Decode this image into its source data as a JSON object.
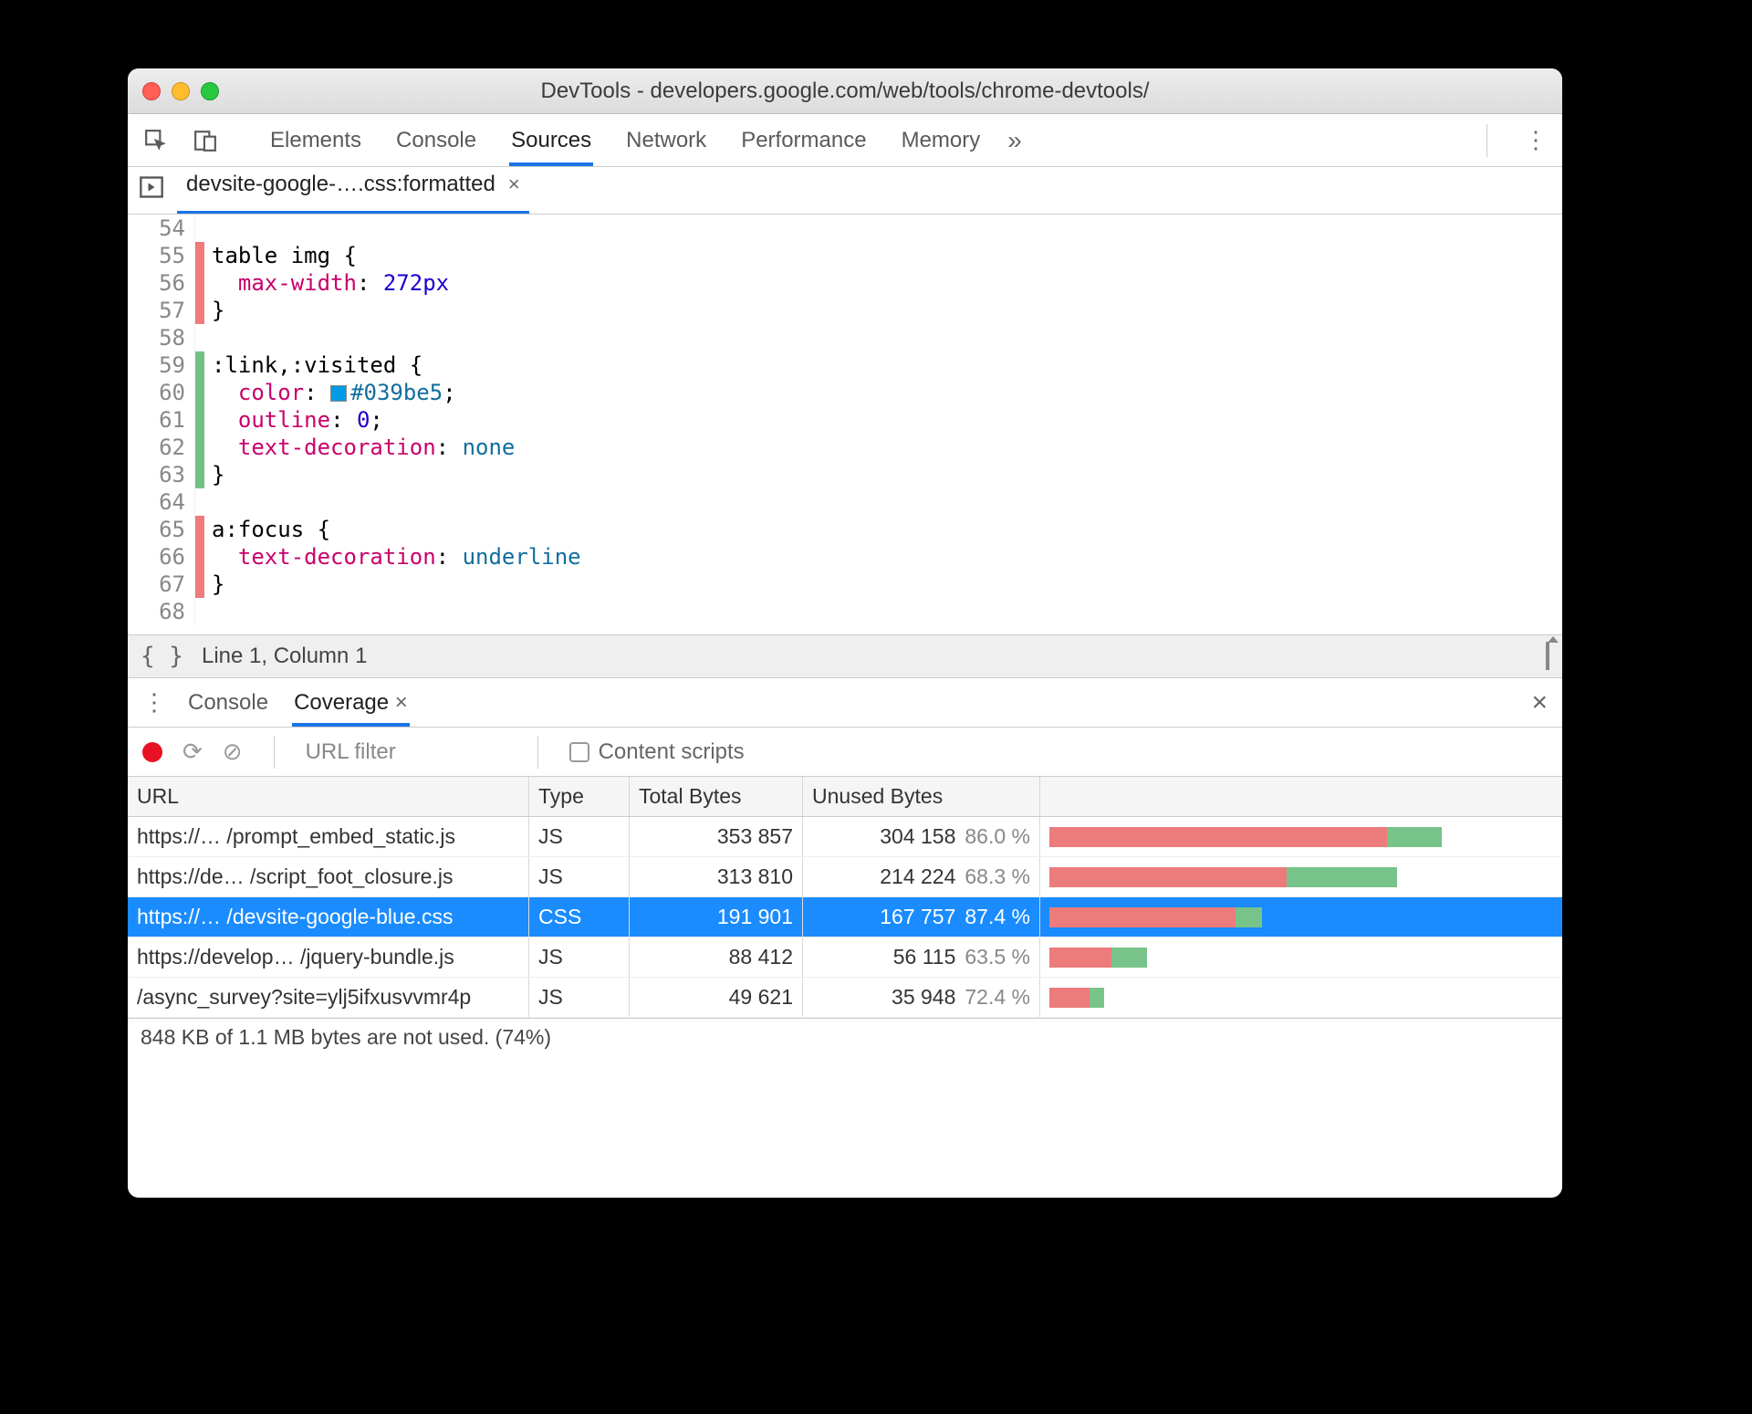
{
  "window": {
    "title": "DevTools - developers.google.com/web/tools/chrome-devtools/"
  },
  "main_tabs": {
    "items": [
      "Elements",
      "Console",
      "Sources",
      "Network",
      "Performance",
      "Memory"
    ],
    "active": "Sources",
    "overflow_glyph": "»"
  },
  "open_file": {
    "label": "devsite-google-….css:formatted"
  },
  "code": {
    "lines": [
      {
        "n": 54,
        "cov": "",
        "tokens": []
      },
      {
        "n": 55,
        "cov": "red",
        "tokens": [
          [
            "sel",
            "table img "
          ],
          [
            "punc",
            "{"
          ]
        ]
      },
      {
        "n": 56,
        "cov": "red",
        "tokens": [
          [
            "indent",
            "  "
          ],
          [
            "prop",
            "max-width"
          ],
          [
            "punc",
            ": "
          ],
          [
            "num",
            "272px"
          ]
        ]
      },
      {
        "n": 57,
        "cov": "red",
        "tokens": [
          [
            "punc",
            "}"
          ]
        ]
      },
      {
        "n": 58,
        "cov": "",
        "tokens": []
      },
      {
        "n": 59,
        "cov": "green",
        "tokens": [
          [
            "sel",
            ":link,:visited "
          ],
          [
            "punc",
            "{"
          ]
        ]
      },
      {
        "n": 60,
        "cov": "green",
        "tokens": [
          [
            "indent",
            "  "
          ],
          [
            "prop",
            "color"
          ],
          [
            "punc",
            ": "
          ],
          [
            "swatch",
            ""
          ],
          [
            "val",
            "#039be5"
          ],
          [
            "punc",
            ";"
          ]
        ]
      },
      {
        "n": 61,
        "cov": "green",
        "tokens": [
          [
            "indent",
            "  "
          ],
          [
            "prop",
            "outline"
          ],
          [
            "punc",
            ": "
          ],
          [
            "num",
            "0"
          ],
          [
            "punc",
            ";"
          ]
        ]
      },
      {
        "n": 62,
        "cov": "green",
        "tokens": [
          [
            "indent",
            "  "
          ],
          [
            "prop",
            "text-decoration"
          ],
          [
            "punc",
            ": "
          ],
          [
            "val",
            "none"
          ]
        ]
      },
      {
        "n": 63,
        "cov": "green",
        "tokens": [
          [
            "punc",
            "}"
          ]
        ]
      },
      {
        "n": 64,
        "cov": "",
        "tokens": []
      },
      {
        "n": 65,
        "cov": "red",
        "tokens": [
          [
            "sel",
            "a:focus "
          ],
          [
            "punc",
            "{"
          ]
        ]
      },
      {
        "n": 66,
        "cov": "red",
        "tokens": [
          [
            "indent",
            "  "
          ],
          [
            "prop",
            "text-decoration"
          ],
          [
            "punc",
            ": "
          ],
          [
            "val",
            "underline"
          ]
        ]
      },
      {
        "n": 67,
        "cov": "red",
        "tokens": [
          [
            "punc",
            "}"
          ]
        ]
      },
      {
        "n": 68,
        "cov": "",
        "tokens": []
      }
    ],
    "status": "Line 1, Column 1",
    "brackets": "{ }"
  },
  "drawer": {
    "tabs": [
      "Console",
      "Coverage"
    ],
    "active": "Coverage"
  },
  "coverage_toolbar": {
    "filter_placeholder": "URL filter",
    "content_scripts_label": "Content scripts"
  },
  "coverage_table": {
    "headers": {
      "url": "URL",
      "type": "Type",
      "total": "Total Bytes",
      "unused": "Unused Bytes"
    },
    "max_bytes": 353857,
    "rows": [
      {
        "url": "https://… /prompt_embed_static.js",
        "type": "JS",
        "total": "353 857",
        "total_n": 353857,
        "unused": "304 158",
        "pct": "86.0 %",
        "pct_n": 86.0,
        "selected": false
      },
      {
        "url": "https://de… /script_foot_closure.js",
        "type": "JS",
        "total": "313 810",
        "total_n": 313810,
        "unused": "214 224",
        "pct": "68.3 %",
        "pct_n": 68.3,
        "selected": false
      },
      {
        "url": "https://… /devsite-google-blue.css",
        "type": "CSS",
        "total": "191 901",
        "total_n": 191901,
        "unused": "167 757",
        "pct": "87.4 %",
        "pct_n": 87.4,
        "selected": true
      },
      {
        "url": "https://develop… /jquery-bundle.js",
        "type": "JS",
        "total": "88 412",
        "total_n": 88412,
        "unused": "56 115",
        "pct": "63.5 %",
        "pct_n": 63.5,
        "selected": false
      },
      {
        "url": "/async_survey?site=ylj5ifxusvvmr4p",
        "type": "JS",
        "total": "49 621",
        "total_n": 49621,
        "unused": "35 948",
        "pct": "72.4 %",
        "pct_n": 72.4,
        "selected": false
      }
    ],
    "summary": "848 KB of 1.1 MB bytes are not used. (74%)"
  }
}
